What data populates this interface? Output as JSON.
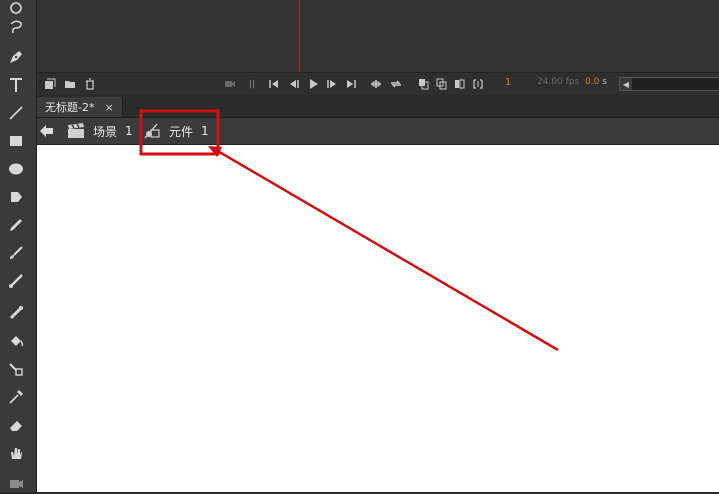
{
  "tabs": {
    "document_title": "无标题-2*",
    "close_symbol": "×"
  },
  "breadcrumb": {
    "scene_label": "场景",
    "scene_number": "1",
    "symbol_label": "元件",
    "symbol_number": "1"
  },
  "timeline": {
    "current_frame": "1",
    "frame_rate": "24.00 fps",
    "elapsed_value": "0.0",
    "elapsed_unit": "s"
  },
  "colors": {
    "annotation": "#d01010",
    "playhead": "#b82020",
    "accent": "#c28b20"
  }
}
